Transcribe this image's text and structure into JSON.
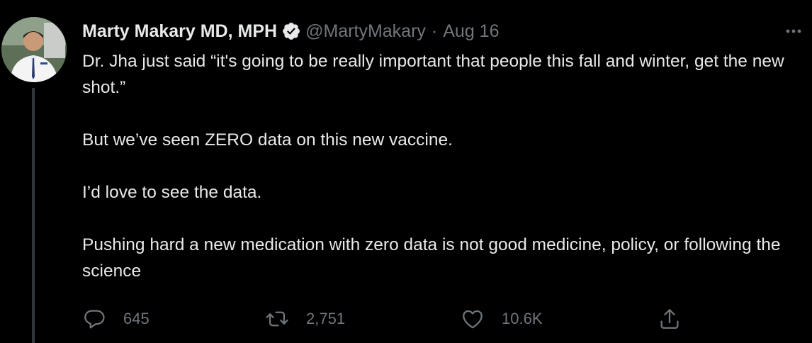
{
  "tweet": {
    "author_name": "Marty Makary MD, MPH",
    "handle": "@MartyMakary",
    "separator": "·",
    "date": "Aug 16",
    "paragraphs": [
      "Dr. Jha just said “it's going to be really important that people this fall and winter, get the new shot.”",
      "But we’ve seen ZERO data on this new vaccine.",
      "I’d love to see the data.",
      "Pushing hard a new medication with zero data is not good medicine, policy, or following the science"
    ],
    "stats": {
      "replies": "645",
      "retweets": "2,751",
      "likes": "10.6K"
    }
  },
  "icons": {
    "verified": "verified-badge-icon",
    "more": "more-horizontal-icon",
    "reply": "reply-icon",
    "retweet": "retweet-icon",
    "like": "heart-icon",
    "share": "share-icon"
  },
  "colors": {
    "background": "#000000",
    "text_primary": "#e7e9ea",
    "text_secondary": "#71767b",
    "thread_line": "#333639"
  }
}
